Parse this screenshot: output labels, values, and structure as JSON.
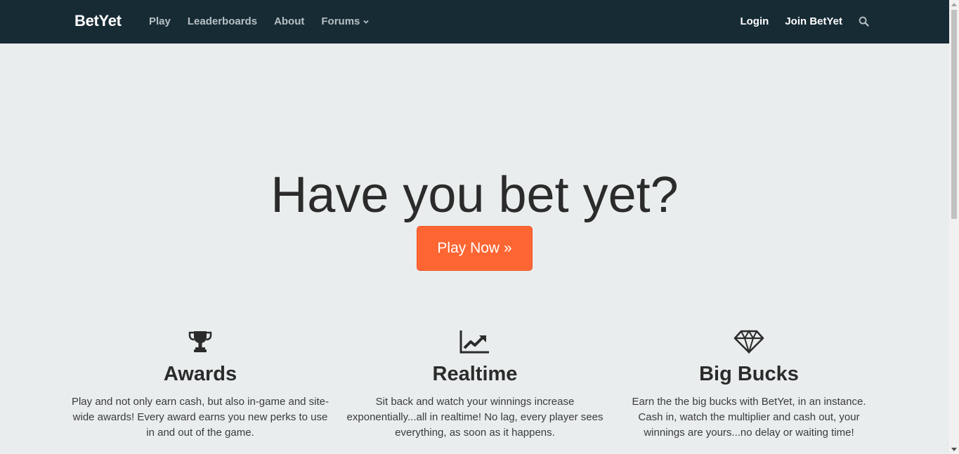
{
  "navbar": {
    "brand": "BetYet",
    "links": [
      {
        "label": "Play"
      },
      {
        "label": "Leaderboards"
      },
      {
        "label": "About"
      },
      {
        "label": "Forums"
      }
    ],
    "right": {
      "login": "Login",
      "join": "Join BetYet"
    }
  },
  "hero": {
    "title": "Have you bet yet?",
    "cta": "Play Now »"
  },
  "features": [
    {
      "icon": "trophy-icon",
      "title": "Awards",
      "text": "Play and not only earn cash, but also in-game and site-wide awards! Every award earns you new perks to use in and out of the game."
    },
    {
      "icon": "line-chart-icon",
      "title": "Realtime",
      "text": "Sit back and watch your winnings increase exponentially...all in realtime! No lag, every player sees everything, as soon as it happens."
    },
    {
      "icon": "diamond-icon",
      "title": "Big Bucks",
      "text": "Earn the the big bucks with BetYet, in an instance. Cash in, watch the multiplier and cash out, your winnings are yours...no delay or waiting time!"
    }
  ],
  "colors": {
    "navbar_bg": "#172b35",
    "page_bg": "#e9eded",
    "accent": "#fd6633"
  }
}
